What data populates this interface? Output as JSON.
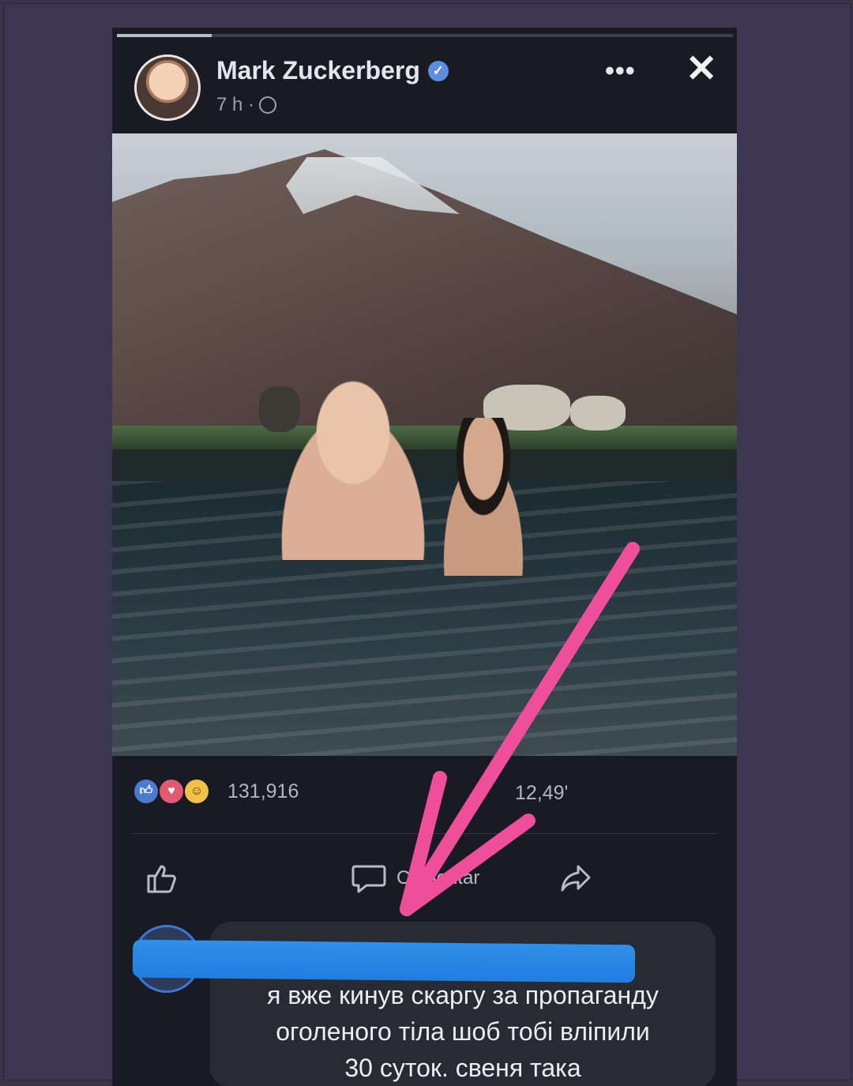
{
  "post": {
    "author": "Mark Zuckerberg",
    "time": "7 h ·",
    "more_label": "•••",
    "close_label": "✕"
  },
  "stats": {
    "reactions_count": "131,916",
    "comments_count": "12,49'"
  },
  "actions": {
    "like_label": "",
    "comment_label": "Comentar",
    "share_label": ""
  },
  "comment": {
    "text": "я вже кинув скаргу за пропаганду\nоголеного тіла шоб тобі вліпили\n30 суток. свеня така"
  },
  "colors": {
    "background": "#3a3448",
    "panel": "#191a24",
    "accent_blue": "#1f7ee0",
    "arrow_pink": "#ef4f9a"
  },
  "icons": [
    "verified-icon",
    "globe-icon",
    "more-icon",
    "close-icon",
    "like-icon",
    "love-icon",
    "haha-icon",
    "thumbs-up-icon",
    "comment-icon",
    "share-icon"
  ]
}
